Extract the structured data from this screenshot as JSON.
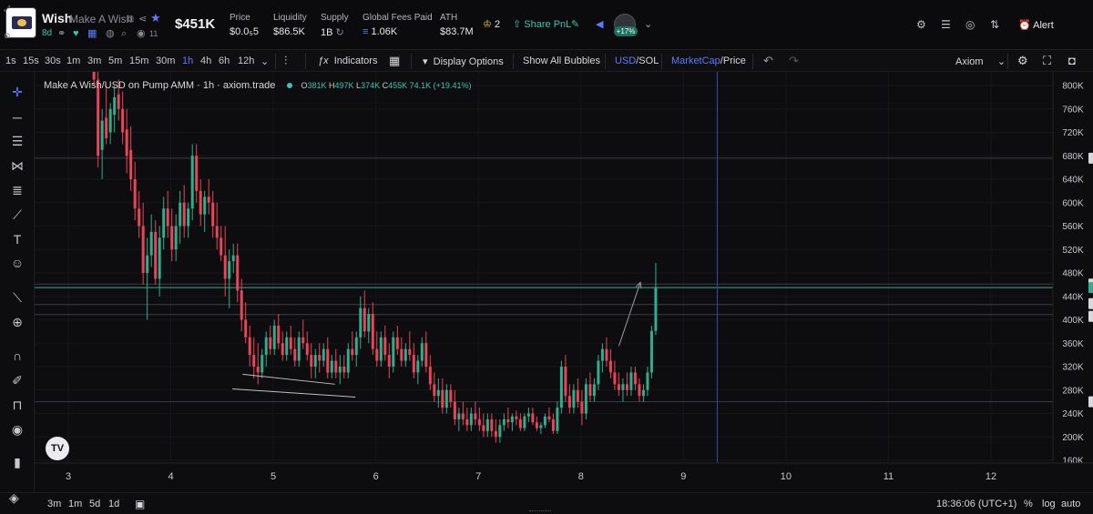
{
  "header": {
    "token_name": "Wish",
    "token_full_name": "Make A Wish",
    "age": "8d",
    "holders_count": "11",
    "market_cap": "$451K",
    "stats": [
      {
        "label": "Price",
        "value": "$0.0₅5"
      },
      {
        "label": "Liquidity",
        "value": "$86.5K"
      },
      {
        "label": "Supply",
        "value": "1B"
      },
      {
        "label": "Global Fees Paid",
        "value": "1.06K"
      },
      {
        "label": "ATH",
        "value": "$83.7M"
      }
    ],
    "badge_count": "2",
    "share_label": "Share PnL",
    "pnl_percent": "+17%",
    "alert_label": "Alert",
    "accent_color": "#3fc3b0",
    "blue_accent": "#5b7cff"
  },
  "toolbar": {
    "timeframes": [
      "1s",
      "15s",
      "30s",
      "1m",
      "3m",
      "5m",
      "15m",
      "30m",
      "1h",
      "4h",
      "6h",
      "12h"
    ],
    "active_timeframe": "1h",
    "indicators_label": "Indicators",
    "display_options_label": "Display Options",
    "bubbles_label": "Show All Bubbles",
    "usd_label": "USD",
    "sol_label": "SOL",
    "marketcap_label": "MarketCap",
    "price_label": "Price",
    "theme_label": "Axiom"
  },
  "legend": {
    "title": "Make A Wish/USD on Pump AMM · 1h · axiom.trade",
    "o": "381K",
    "h": "497K",
    "l": "374K",
    "c": "455K",
    "change": "74.1K (+19.41%)"
  },
  "bottombar": {
    "ranges": [
      "3m",
      "1m",
      "5d",
      "1d"
    ],
    "time": "18:36:06 (UTC+1)",
    "percent_label": "%",
    "log_label": "log",
    "auto_label": "auto"
  },
  "chart_data": {
    "type": "candlestick",
    "title": "Make A Wish/USD on Pump AMM · 1h · axiom.trade",
    "x_ticks": [
      "3",
      "4",
      "5",
      "6",
      "7",
      "8",
      "9",
      "10",
      "11",
      "12"
    ],
    "y_ticks": [
      "800K",
      "760K",
      "720K",
      "680K",
      "640K",
      "600K",
      "560K",
      "520K",
      "480K",
      "440K",
      "400K",
      "360K",
      "320K",
      "280K",
      "240K",
      "200K",
      "160K"
    ],
    "ylim": [
      150000,
      810000
    ],
    "x_range": [
      2.77,
      12.3
    ],
    "price_labels": [
      {
        "label": "676K",
        "value": 676000,
        "style": "gray"
      },
      {
        "label": "461K",
        "value": 461000,
        "style": "gray"
      },
      {
        "label": "455K",
        "value": 455000,
        "style": "green"
      },
      {
        "label": "426K",
        "value": 426000,
        "style": "gray"
      },
      {
        "label": "409K",
        "value": 409000,
        "style": "gray"
      },
      {
        "label": "260K",
        "value": 260000,
        "style": "gray"
      }
    ],
    "horizontal_lines": [
      676000,
      461000,
      455000,
      426000,
      409000,
      260000
    ],
    "vertical_line_x": 9.33,
    "trendline": [
      [
        4.7,
        307000
      ],
      [
        5.6,
        290000
      ]
    ],
    "trendline2": [
      [
        4.6,
        282000
      ],
      [
        5.8,
        268000
      ]
    ],
    "arrow": [
      [
        8.37,
        355000
      ],
      [
        8.58,
        464000
      ]
    ],
    "up_color": "#2fae8e",
    "down_color": "#e8455a",
    "candles": [
      [
        3.25,
        840000,
        880000,
        800000,
        810000
      ],
      [
        3.29,
        810000,
        830000,
        660000,
        680000
      ],
      [
        3.33,
        690000,
        760000,
        640000,
        740000
      ],
      [
        3.37,
        745000,
        800000,
        700000,
        710000
      ],
      [
        3.41,
        720000,
        770000,
        700000,
        760000
      ],
      [
        3.45,
        750000,
        800000,
        720000,
        780000
      ],
      [
        3.49,
        785000,
        810000,
        740000,
        760000
      ],
      [
        3.53,
        760000,
        790000,
        700000,
        720000
      ],
      [
        3.57,
        725000,
        760000,
        650000,
        680000
      ],
      [
        3.61,
        690000,
        730000,
        620000,
        640000
      ],
      [
        3.65,
        640000,
        670000,
        570000,
        590000
      ],
      [
        3.69,
        590000,
        620000,
        540000,
        560000
      ],
      [
        3.73,
        560000,
        600000,
        460000,
        480000
      ],
      [
        3.77,
        480000,
        540000,
        400000,
        510000
      ],
      [
        3.81,
        510000,
        580000,
        490000,
        550000
      ],
      [
        3.85,
        550000,
        570000,
        460000,
        470000
      ],
      [
        3.89,
        470000,
        560000,
        440000,
        540000
      ],
      [
        3.93,
        540000,
        610000,
        520000,
        590000
      ],
      [
        3.97,
        590000,
        620000,
        540000,
        560000
      ],
      [
        4.01,
        560000,
        590000,
        500000,
        520000
      ],
      [
        4.05,
        520000,
        580000,
        500000,
        560000
      ],
      [
        4.09,
        560000,
        620000,
        530000,
        600000
      ],
      [
        4.13,
        600000,
        630000,
        540000,
        560000
      ],
      [
        4.17,
        560000,
        600000,
        540000,
        590000
      ],
      [
        4.21,
        590000,
        700000,
        570000,
        680000
      ],
      [
        4.25,
        680000,
        700000,
        600000,
        620000
      ],
      [
        4.29,
        620000,
        640000,
        560000,
        580000
      ],
      [
        4.33,
        580000,
        620000,
        550000,
        610000
      ],
      [
        4.37,
        610000,
        640000,
        580000,
        600000
      ],
      [
        4.41,
        600000,
        620000,
        540000,
        560000
      ],
      [
        4.45,
        560000,
        600000,
        520000,
        540000
      ],
      [
        4.49,
        540000,
        560000,
        500000,
        510000
      ],
      [
        4.53,
        510000,
        560000,
        440000,
        470000
      ],
      [
        4.57,
        470000,
        520000,
        420000,
        500000
      ],
      [
        4.61,
        500000,
        530000,
        480000,
        510000
      ],
      [
        4.65,
        510000,
        530000,
        430000,
        450000
      ],
      [
        4.69,
        450000,
        470000,
        380000,
        400000
      ],
      [
        4.73,
        400000,
        430000,
        360000,
        370000
      ],
      [
        4.77,
        370000,
        390000,
        320000,
        340000
      ],
      [
        4.81,
        340000,
        370000,
        300000,
        320000
      ],
      [
        4.85,
        320000,
        360000,
        290000,
        310000
      ],
      [
        4.89,
        310000,
        350000,
        300000,
        340000
      ],
      [
        4.93,
        340000,
        380000,
        320000,
        370000
      ],
      [
        4.97,
        370000,
        390000,
        340000,
        350000
      ],
      [
        5.01,
        350000,
        400000,
        340000,
        390000
      ],
      [
        5.05,
        390000,
        410000,
        350000,
        360000
      ],
      [
        5.09,
        360000,
        380000,
        330000,
        340000
      ],
      [
        5.13,
        340000,
        380000,
        330000,
        370000
      ],
      [
        5.17,
        370000,
        390000,
        340000,
        350000
      ],
      [
        5.21,
        350000,
        370000,
        320000,
        330000
      ],
      [
        5.25,
        330000,
        380000,
        320000,
        370000
      ],
      [
        5.29,
        370000,
        400000,
        350000,
        360000
      ],
      [
        5.33,
        360000,
        380000,
        330000,
        340000
      ],
      [
        5.37,
        340000,
        360000,
        300000,
        320000
      ],
      [
        5.41,
        320000,
        350000,
        300000,
        340000
      ],
      [
        5.45,
        340000,
        360000,
        310000,
        330000
      ],
      [
        5.49,
        330000,
        360000,
        320000,
        350000
      ],
      [
        5.53,
        350000,
        370000,
        300000,
        310000
      ],
      [
        5.57,
        310000,
        340000,
        300000,
        330000
      ],
      [
        5.61,
        330000,
        350000,
        300000,
        310000
      ],
      [
        5.65,
        310000,
        340000,
        290000,
        320000
      ],
      [
        5.69,
        320000,
        340000,
        300000,
        310000
      ],
      [
        5.73,
        310000,
        360000,
        300000,
        350000
      ],
      [
        5.77,
        350000,
        380000,
        330000,
        340000
      ],
      [
        5.81,
        340000,
        380000,
        320000,
        370000
      ],
      [
        5.85,
        370000,
        440000,
        350000,
        420000
      ],
      [
        5.89,
        420000,
        450000,
        370000,
        380000
      ],
      [
        5.93,
        380000,
        420000,
        360000,
        410000
      ],
      [
        5.97,
        410000,
        430000,
        340000,
        350000
      ],
      [
        6.01,
        350000,
        380000,
        320000,
        330000
      ],
      [
        6.05,
        330000,
        380000,
        320000,
        370000
      ],
      [
        6.09,
        370000,
        390000,
        330000,
        340000
      ],
      [
        6.13,
        340000,
        360000,
        300000,
        320000
      ],
      [
        6.17,
        320000,
        380000,
        310000,
        370000
      ],
      [
        6.21,
        370000,
        390000,
        340000,
        350000
      ],
      [
        6.25,
        350000,
        370000,
        320000,
        330000
      ],
      [
        6.29,
        330000,
        360000,
        320000,
        350000
      ],
      [
        6.33,
        350000,
        380000,
        330000,
        340000
      ],
      [
        6.37,
        340000,
        360000,
        300000,
        310000
      ],
      [
        6.41,
        310000,
        340000,
        290000,
        330000
      ],
      [
        6.45,
        330000,
        370000,
        320000,
        360000
      ],
      [
        6.49,
        360000,
        380000,
        310000,
        320000
      ],
      [
        6.53,
        320000,
        340000,
        280000,
        290000
      ],
      [
        6.57,
        290000,
        310000,
        260000,
        270000
      ],
      [
        6.61,
        270000,
        300000,
        250000,
        280000
      ],
      [
        6.65,
        280000,
        300000,
        240000,
        250000
      ],
      [
        6.69,
        250000,
        290000,
        240000,
        280000
      ],
      [
        6.73,
        280000,
        290000,
        250000,
        260000
      ],
      [
        6.77,
        260000,
        280000,
        220000,
        230000
      ],
      [
        6.81,
        230000,
        250000,
        210000,
        240000
      ],
      [
        6.85,
        240000,
        260000,
        220000,
        230000
      ],
      [
        6.89,
        230000,
        250000,
        210000,
        220000
      ],
      [
        6.93,
        220000,
        250000,
        210000,
        240000
      ],
      [
        6.97,
        240000,
        260000,
        220000,
        230000
      ],
      [
        7.01,
        230000,
        250000,
        210000,
        220000
      ],
      [
        7.05,
        220000,
        240000,
        200000,
        210000
      ],
      [
        7.09,
        210000,
        240000,
        200000,
        230000
      ],
      [
        7.13,
        230000,
        240000,
        200000,
        210000
      ],
      [
        7.17,
        210000,
        230000,
        190000,
        200000
      ],
      [
        7.21,
        200000,
        230000,
        190000,
        220000
      ],
      [
        7.25,
        220000,
        240000,
        210000,
        230000
      ],
      [
        7.29,
        230000,
        250000,
        215000,
        225000
      ],
      [
        7.33,
        225000,
        240000,
        210000,
        235000
      ],
      [
        7.37,
        235000,
        245000,
        220000,
        230000
      ],
      [
        7.41,
        230000,
        240000,
        210000,
        215000
      ],
      [
        7.45,
        215000,
        240000,
        210000,
        235000
      ],
      [
        7.49,
        235000,
        250000,
        225000,
        240000
      ],
      [
        7.53,
        240000,
        250000,
        220000,
        225000
      ],
      [
        7.57,
        225000,
        235000,
        210000,
        215000
      ],
      [
        7.61,
        215000,
        225000,
        205000,
        220000
      ],
      [
        7.65,
        220000,
        240000,
        215000,
        235000
      ],
      [
        7.69,
        235000,
        250000,
        225000,
        230000
      ],
      [
        7.73,
        230000,
        240000,
        205000,
        210000
      ],
      [
        7.77,
        210000,
        260000,
        205000,
        250000
      ],
      [
        7.81,
        250000,
        330000,
        240000,
        320000
      ],
      [
        7.85,
        320000,
        340000,
        260000,
        270000
      ],
      [
        7.89,
        270000,
        290000,
        240000,
        250000
      ],
      [
        7.93,
        250000,
        290000,
        240000,
        280000
      ],
      [
        7.97,
        280000,
        300000,
        250000,
        260000
      ],
      [
        8.01,
        260000,
        280000,
        220000,
        240000
      ],
      [
        8.05,
        240000,
        300000,
        230000,
        290000
      ],
      [
        8.09,
        290000,
        310000,
        260000,
        270000
      ],
      [
        8.13,
        270000,
        300000,
        260000,
        290000
      ],
      [
        8.17,
        290000,
        340000,
        280000,
        330000
      ],
      [
        8.21,
        330000,
        360000,
        310000,
        350000
      ],
      [
        8.25,
        350000,
        370000,
        320000,
        330000
      ],
      [
        8.29,
        330000,
        350000,
        300000,
        310000
      ],
      [
        8.33,
        310000,
        330000,
        280000,
        290000
      ],
      [
        8.37,
        290000,
        310000,
        270000,
        280000
      ],
      [
        8.41,
        280000,
        300000,
        260000,
        290000
      ],
      [
        8.45,
        290000,
        310000,
        270000,
        280000
      ],
      [
        8.49,
        280000,
        320000,
        270000,
        310000
      ],
      [
        8.53,
        310000,
        320000,
        280000,
        290000
      ],
      [
        8.57,
        290000,
        300000,
        260000,
        270000
      ],
      [
        8.61,
        270000,
        290000,
        260000,
        280000
      ],
      [
        8.65,
        280000,
        320000,
        270000,
        310000
      ],
      [
        8.69,
        310000,
        390000,
        300000,
        381000
      ],
      [
        8.73,
        381000,
        497000,
        374000,
        455000
      ]
    ]
  }
}
